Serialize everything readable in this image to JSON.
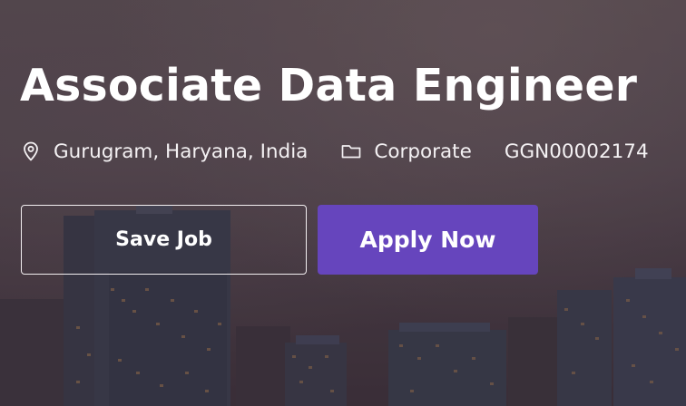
{
  "job": {
    "title": "Associate Data Engineer",
    "location": "Gurugram, Haryana, India",
    "category": "Corporate",
    "job_id": "GGN00002174"
  },
  "actions": {
    "save_label": "Save Job",
    "apply_label": "Apply Now"
  },
  "icons": {
    "location": "location-pin-icon",
    "category": "folder-icon"
  },
  "colors": {
    "apply_button": "#6645bd",
    "text": "#ffffff",
    "background": "#4a3f46"
  }
}
